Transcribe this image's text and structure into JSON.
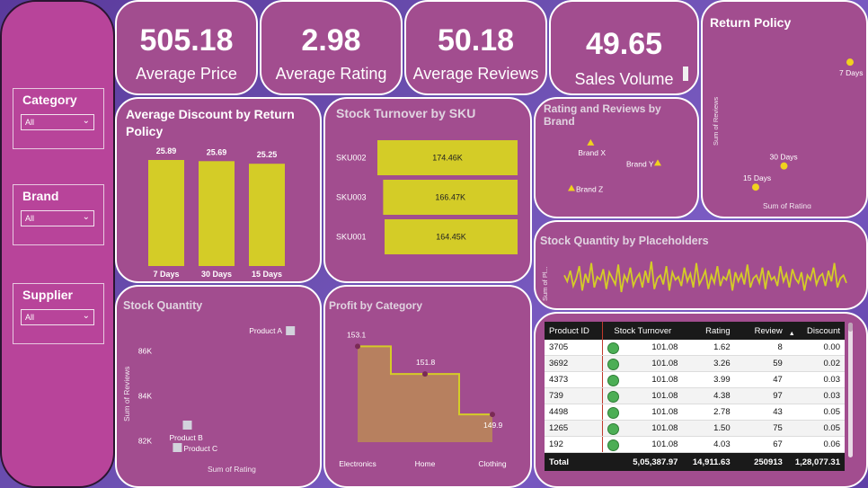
{
  "kpis": {
    "avg_price": {
      "value": "505.18",
      "label": "Average Price"
    },
    "avg_rating": {
      "value": "2.98",
      "label": "Average Rating"
    },
    "avg_reviews": {
      "value": "50.18",
      "label": "Average Reviews"
    },
    "sales_volume": {
      "value": "49.65",
      "label": "Sales Volume"
    }
  },
  "slicers": {
    "category": {
      "title": "Category",
      "value": "All"
    },
    "brand": {
      "title": "Brand",
      "value": "All"
    },
    "supplier": {
      "title": "Supplier",
      "value": "All"
    }
  },
  "titles": {
    "discount": "Average Discount by Return Policy",
    "stock_turnover": "Stock Turnover by SKU",
    "rating_reviews": "Rating and Reviews by Brand",
    "return_policy": "Return Policy",
    "stock_placeholders": "Stock Quantity by Placeholders",
    "stock_quantity": "Stock Quantity",
    "profit_category": "Profit by Category"
  },
  "colors": {
    "card": "#a24d8f",
    "accent_yellow": "#d4cc27",
    "marker_yellow": "#f0d21e",
    "profit_fill": "#b7805f",
    "status_green": "#4cae55"
  },
  "table": {
    "columns": [
      "Product ID",
      "Stock Turnover",
      "Rating",
      "Review",
      "Discount"
    ],
    "sort_column": "Discount",
    "sort_direction": "ascending",
    "rows": [
      {
        "id": "3705",
        "turnover": "101.08",
        "rating": "1.62",
        "review": "8",
        "discount": "0.00"
      },
      {
        "id": "3692",
        "turnover": "101.08",
        "rating": "3.26",
        "review": "59",
        "discount": "0.02"
      },
      {
        "id": "4373",
        "turnover": "101.08",
        "rating": "3.99",
        "review": "47",
        "discount": "0.03"
      },
      {
        "id": "739",
        "turnover": "101.08",
        "rating": "4.38",
        "review": "97",
        "discount": "0.03"
      },
      {
        "id": "4498",
        "turnover": "101.08",
        "rating": "2.78",
        "review": "43",
        "discount": "0.05"
      },
      {
        "id": "1265",
        "turnover": "101.08",
        "rating": "1.50",
        "review": "75",
        "discount": "0.05"
      },
      {
        "id": "192",
        "turnover": "101.08",
        "rating": "4.03",
        "review": "67",
        "discount": "0.06"
      }
    ],
    "total": {
      "label": "Total",
      "turnover": "5,05,387.97",
      "rating": "14,911.63",
      "review": "250913",
      "discount": "1,28,077.31"
    }
  },
  "chart_data": [
    {
      "id": "discount",
      "type": "bar",
      "title": "Average Discount by Return Policy",
      "categories": [
        "7 Days",
        "30 Days",
        "15 Days"
      ],
      "values": [
        25.89,
        25.69,
        25.25
      ],
      "labels": [
        "25.89",
        "25.69",
        "25.25"
      ]
    },
    {
      "id": "stock_turnover",
      "type": "bar",
      "orientation": "horizontal",
      "title": "Stock Turnover by SKU",
      "categories": [
        "SKU002",
        "SKU003",
        "SKU001"
      ],
      "values": [
        174460,
        166470,
        164450
      ],
      "labels": [
        "174.46K",
        "166.47K",
        "164.45K"
      ]
    },
    {
      "id": "rating_reviews",
      "type": "scatter",
      "title": "Rating and Reviews by Brand",
      "points": [
        {
          "label": "Brand X",
          "x": 2.95,
          "y": 50.6
        },
        {
          "label": "Brand Y",
          "x": 3.02,
          "y": 50.2
        },
        {
          "label": "Brand Z",
          "x": 2.93,
          "y": 49.7
        }
      ]
    },
    {
      "id": "return_policy",
      "type": "scatter",
      "title": "Return Policy",
      "xlabel": "Sum of Rating",
      "ylabel": "Sum of Reviews",
      "points": [
        {
          "label": "7 Days",
          "x": 5140,
          "y": 86900
        },
        {
          "label": "30 Days",
          "x": 4930,
          "y": 82000
        },
        {
          "label": "15 Days",
          "x": 4840,
          "y": 81000
        }
      ]
    },
    {
      "id": "stock_placeholders",
      "type": "line",
      "title": "Stock Quantity by Placeholders",
      "ylabel": "Sum of Pl...",
      "values": [
        52,
        48,
        55,
        45,
        50,
        58,
        42,
        53,
        47,
        60,
        44,
        51,
        49,
        56,
        43,
        54,
        50,
        46,
        59,
        41,
        52,
        48,
        57,
        45,
        50,
        53,
        44,
        55,
        47,
        61,
        43,
        50,
        52,
        46,
        58,
        42,
        54,
        49,
        51,
        45,
        57,
        48,
        53,
        44,
        60,
        46,
        50,
        55,
        43,
        52,
        47,
        58,
        45,
        51,
        49,
        56,
        42,
        54,
        48,
        53,
        46,
        59,
        44,
        50,
        52,
        47,
        57,
        43,
        55,
        49,
        51,
        45,
        58,
        48,
        53,
        44,
        56,
        50,
        47,
        54,
        42,
        52,
        49,
        57,
        46,
        51,
        53,
        45,
        55,
        48,
        60,
        44,
        50,
        52,
        47
      ]
    },
    {
      "id": "stock_quantity",
      "type": "scatter",
      "title": "Stock Quantity",
      "xlabel": "Sum of Rating",
      "ylabel": "Sum of Reviews",
      "yticks": [
        "86K",
        "84K",
        "82K"
      ],
      "ylim": [
        81500,
        87500
      ],
      "xlim": [
        4780,
        5180
      ],
      "points": [
        {
          "label": "Product A",
          "x": 5140,
          "y": 86900
        },
        {
          "label": "Product B",
          "x": 4830,
          "y": 82700
        },
        {
          "label": "Product C",
          "x": 4800,
          "y": 81700
        }
      ]
    },
    {
      "id": "profit_category",
      "type": "area",
      "title": "Profit by Category",
      "categories": [
        "Electronics",
        "Home",
        "Clothing"
      ],
      "values": [
        153.1,
        151.8,
        149.9
      ],
      "labels": [
        "153.1",
        "151.8",
        "149.9"
      ],
      "ylim": [
        148.6,
        154
      ]
    }
  ]
}
